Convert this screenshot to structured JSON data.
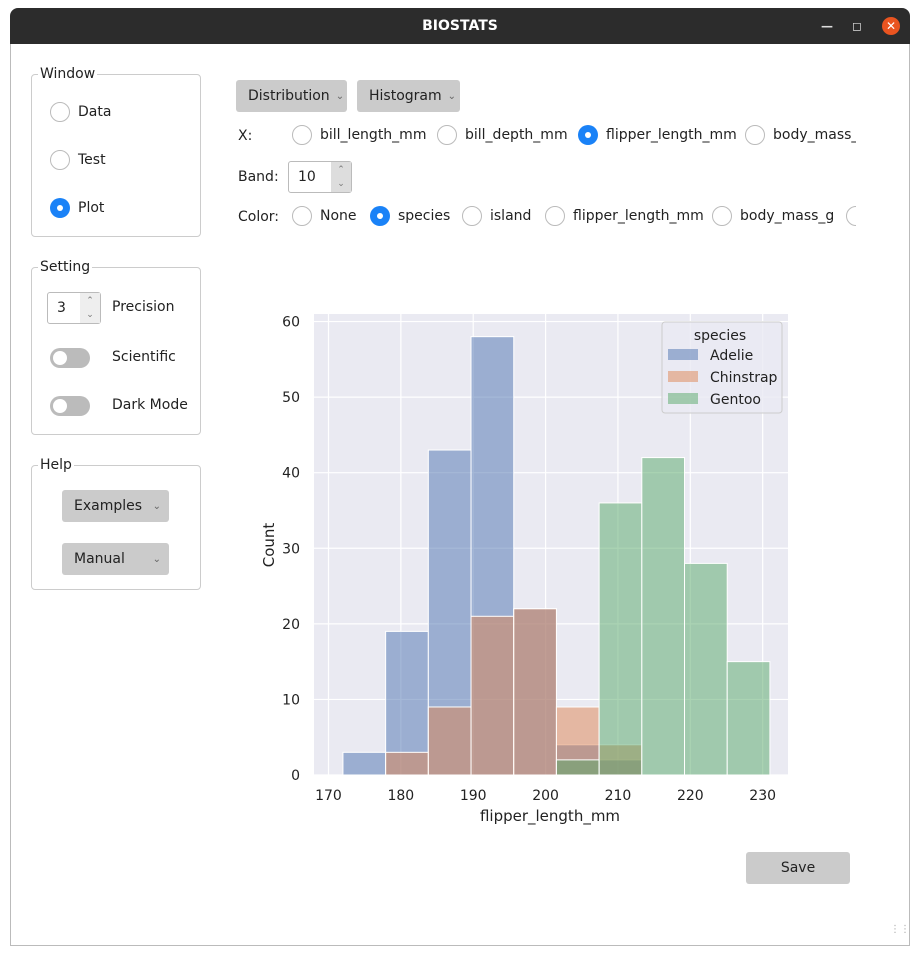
{
  "window": {
    "title": "BIOSTATS"
  },
  "sidebar": {
    "window_group": {
      "title": "Window",
      "options": [
        "Data",
        "Test",
        "Plot"
      ],
      "selected": "Plot"
    },
    "setting_group": {
      "title": "Setting",
      "precision_value": "3",
      "precision_label": "Precision",
      "scientific_label": "Scientific",
      "scientific_on": false,
      "dark_mode_label": "Dark Mode",
      "dark_mode_on": false
    },
    "help_group": {
      "title": "Help",
      "examples_label": "Examples",
      "manual_label": "Manual"
    }
  },
  "toolbar": {
    "plot_type": "Distribution",
    "plot_kind": "Histogram"
  },
  "x_selector": {
    "label": "X:",
    "options": [
      "bill_length_mm",
      "bill_depth_mm",
      "flipper_length_mm",
      "body_mass_g"
    ],
    "selected": "flipper_length_mm"
  },
  "band": {
    "label": "Band:",
    "value": "10"
  },
  "color_selector": {
    "label": "Color:",
    "options": [
      "None",
      "species",
      "island",
      "flipper_length_mm",
      "body_mass_g"
    ],
    "selected": "species"
  },
  "save_label": "Save",
  "chart_data": {
    "type": "bar",
    "xlabel": "flipper_length_mm",
    "ylabel": "Count",
    "xlim": [
      168,
      233.5
    ],
    "ylim": [
      0,
      61
    ],
    "xticks": [
      170,
      180,
      190,
      200,
      210,
      220,
      230
    ],
    "yticks": [
      0,
      10,
      20,
      30,
      40,
      50,
      60
    ],
    "bin_edges": [
      172,
      177.9,
      183.8,
      189.7,
      195.6,
      201.5,
      207.4,
      213.3,
      219.2,
      225.1,
      231
    ],
    "legend": {
      "title": "species",
      "placement": "top-right"
    },
    "series": [
      {
        "name": "Adelie",
        "color": "#4c72b0",
        "values": [
          3,
          19,
          43,
          58,
          22,
          4,
          2,
          0,
          0,
          0
        ]
      },
      {
        "name": "Chinstrap",
        "color": "#dd8452",
        "values": [
          0,
          3,
          9,
          21,
          22,
          9,
          4,
          0,
          0,
          0
        ]
      },
      {
        "name": "Gentoo",
        "color": "#55a868",
        "values": [
          0,
          0,
          0,
          0,
          0,
          2,
          36,
          42,
          28,
          15
        ]
      }
    ],
    "grid": true
  }
}
